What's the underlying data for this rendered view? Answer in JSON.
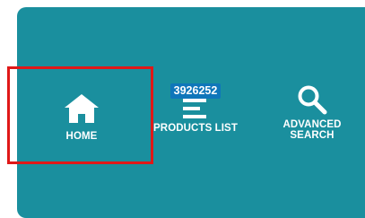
{
  "nav": {
    "items": [
      {
        "label": "HOME",
        "icon": "home-icon"
      },
      {
        "label": "PRODUCTS LIST",
        "icon": "list-icon",
        "badge": "3926252"
      },
      {
        "label_line1": "ADVANCED",
        "label_line2": "SEARCH",
        "icon": "search-icon"
      }
    ]
  },
  "colors": {
    "panel": "#1a8f9e",
    "badge": "#0f76ba",
    "highlight": "#e01818",
    "text": "#ffffff"
  }
}
